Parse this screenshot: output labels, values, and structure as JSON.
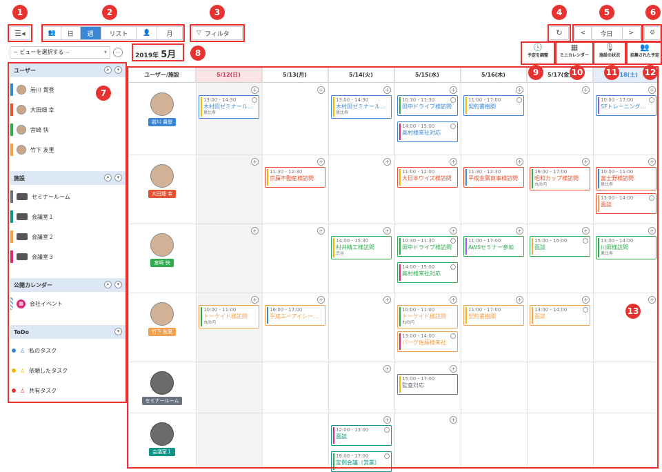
{
  "toolbar": {
    "view_day": "日",
    "view_week": "週",
    "view_list": "リスト",
    "view_month": "月",
    "filter": "フィルタ",
    "prev": "<",
    "today": "今日",
    "next": ">"
  },
  "date_label": {
    "year": "2019年",
    "month": "5月"
  },
  "view_select": "-- ビューを選択する --",
  "actions": {
    "adjust": "予定を調整",
    "minical": "ミニカレンダー",
    "facility": "施設の状況",
    "invited": "招集された予定"
  },
  "sidebar": {
    "users_title": "ユーザー",
    "users": [
      {
        "name": "岩川 貴登",
        "color": "#3a86d6"
      },
      {
        "name": "大田畑 幸",
        "color": "#e8512f"
      },
      {
        "name": "宮崎 快",
        "color": "#2faa4f"
      },
      {
        "name": "竹下 友里",
        "color": "#f5a04a"
      }
    ],
    "facilities_title": "施設",
    "facilities": [
      {
        "name": "セミナールーム",
        "color": "#6b7280"
      },
      {
        "name": "会議室１",
        "color": "#0d9488"
      },
      {
        "name": "会議室２",
        "color": "#f5a04a"
      },
      {
        "name": "会議室３",
        "color": "#db2777"
      }
    ],
    "public_title": "公開カレンダー",
    "public": [
      {
        "name": "会社イベント"
      }
    ],
    "todo_title": "ToDo",
    "todo": [
      {
        "name": "私のタスク",
        "color": "#3a86d6"
      },
      {
        "name": "依頼したタスク",
        "color": "#f5b400"
      },
      {
        "name": "共有タスク",
        "color": "#e8322f"
      }
    ]
  },
  "grid": {
    "corner": "ユーザー/施設",
    "days": [
      "5/12(日)",
      "5/13(月)",
      "5/14(火)",
      "5/15(水)",
      "5/16(木)",
      "5/17(金)",
      "5/18(土)"
    ],
    "rows": [
      {
        "name": "岩川 貴登",
        "tag": "#3a86d6"
      },
      {
        "name": "大田畑 幸",
        "tag": "#e8512f"
      },
      {
        "name": "宮崎 快",
        "tag": "#2faa4f"
      },
      {
        "name": "竹下 友里",
        "tag": "#f5a04a"
      },
      {
        "name": "セミナールーム",
        "tag": "#6b7280"
      },
      {
        "name": "会議室１",
        "tag": "#0d9488"
      }
    ],
    "events": [
      {
        "row": 0,
        "day": 0,
        "slot": 0,
        "time": "13:00 - 14:30",
        "title": "木村田ゼミナール…",
        "loc": "恵比寿",
        "color": "#3a86d6",
        "bar": "#f5b400",
        "mark": true
      },
      {
        "row": 0,
        "day": 2,
        "slot": 0,
        "time": "13:00 - 14:30",
        "title": "木村田ゼミナール…",
        "loc": "恵比寿",
        "color": "#3a86d6",
        "bar": "#f5b400",
        "mark": false
      },
      {
        "row": 0,
        "day": 3,
        "slot": 0,
        "time": "10:30 - 11:30",
        "title": "田中ドライブ様訪問",
        "loc": "",
        "color": "#3a86d6",
        "bar": "#2faa4f",
        "mark": true
      },
      {
        "row": 0,
        "day": 3,
        "slot": 1,
        "time": "14:00 - 15:00",
        "title": "高村様来社対応",
        "loc": "",
        "color": "#3a86d6",
        "bar": "#db2777",
        "mark": true
      },
      {
        "row": 0,
        "day": 4,
        "slot": 0,
        "time": "11:00 - 17:00",
        "title": "契約書樹脚",
        "loc": "",
        "color": "#3a86d6",
        "bar": "#f5b400",
        "mark": true
      },
      {
        "row": 0,
        "day": 6,
        "slot": 0,
        "time": "10:00 - 17:00",
        "title": "SFトレーニング…",
        "loc": "",
        "color": "#3a86d6",
        "bar": "#8b5cf6",
        "mark": true
      },
      {
        "row": 1,
        "day": 1,
        "slot": 0,
        "time": "11:30 - 12:30",
        "title": "京藤不動産様訪問",
        "loc": "",
        "color": "#e8512f",
        "bar": "#f5b400",
        "mark": false
      },
      {
        "row": 1,
        "day": 3,
        "slot": 0,
        "time": "11:00 - 12:00",
        "title": "大日本ワイズ様訪問",
        "loc": "",
        "color": "#e8512f",
        "bar": "#f5b400",
        "mark": false
      },
      {
        "row": 1,
        "day": 4,
        "slot": 0,
        "time": "11:30 - 12:30",
        "title": "平成金属商事様訪問",
        "loc": "",
        "color": "#e8512f",
        "bar": "#3a86d6",
        "mark": false
      },
      {
        "row": 1,
        "day": 5,
        "slot": 0,
        "time": "16:00 - 17:00",
        "title": "昭和カップ様訪問",
        "loc": "丸の内",
        "color": "#e8512f",
        "bar": "#2faa4f",
        "mark": false
      },
      {
        "row": 1,
        "day": 6,
        "slot": 0,
        "time": "10:00 - 11:00",
        "title": "富士野様訪問",
        "loc": "恵比寿",
        "color": "#e8512f",
        "bar": "#3a86d6",
        "mark": false
      },
      {
        "row": 1,
        "day": 6,
        "slot": 1,
        "time": "13:00 - 14:00",
        "title": "面談",
        "loc": "",
        "color": "#e8512f",
        "bar": "#f5a04a",
        "mark": true
      },
      {
        "row": 2,
        "day": 2,
        "slot": 0,
        "time": "14:00 - 15:30",
        "title": "村井精工様訪問",
        "loc": "渋谷",
        "color": "#2faa4f",
        "bar": "#f5b400",
        "mark": false
      },
      {
        "row": 2,
        "day": 3,
        "slot": 0,
        "time": "10:30 - 11:30",
        "title": "田中ドライブ様訪問",
        "loc": "",
        "color": "#2faa4f",
        "bar": "#2faa4f",
        "mark": true
      },
      {
        "row": 2,
        "day": 3,
        "slot": 1,
        "time": "14:00 - 15:00",
        "title": "高村様来社対応",
        "loc": "",
        "color": "#2faa4f",
        "bar": "#db2777",
        "mark": true
      },
      {
        "row": 2,
        "day": 4,
        "slot": 0,
        "time": "11:00 - 17:00",
        "title": "AWSセミナー参加",
        "loc": "",
        "color": "#2faa4f",
        "bar": "#8b5cf6",
        "mark": false
      },
      {
        "row": 2,
        "day": 5,
        "slot": 0,
        "time": "15:00 - 16:00",
        "title": "面談",
        "loc": "",
        "color": "#2faa4f",
        "bar": "#f5a04a",
        "mark": true
      },
      {
        "row": 2,
        "day": 6,
        "slot": 0,
        "time": "13:00 - 14:00",
        "title": "川田様訪問",
        "loc": "恵比寿",
        "color": "#2faa4f",
        "bar": "#2faa4f",
        "mark": false
      },
      {
        "row": 3,
        "day": 0,
        "slot": 0,
        "time": "10:00 - 11:00",
        "title": "トーケイド様訪問",
        "loc": "丸の内",
        "color": "#f5a04a",
        "bar": "#2faa4f",
        "mark": false
      },
      {
        "row": 3,
        "day": 1,
        "slot": 0,
        "time": "16:00 - 17:00",
        "title": "平成エーアイシー…",
        "loc": "",
        "color": "#f5a04a",
        "bar": "#3a86d6",
        "mark": false
      },
      {
        "row": 3,
        "day": 3,
        "slot": 0,
        "time": "10:00 - 11:00",
        "title": "トーケイド様訪問",
        "loc": "丸の内",
        "color": "#f5a04a",
        "bar": "#2faa4f",
        "mark": false
      },
      {
        "row": 3,
        "day": 3,
        "slot": 1,
        "time": "13:00 - 14:00",
        "title": "バーグ佐藤様来社",
        "loc": "",
        "color": "#f5a04a",
        "bar": "#db2777",
        "mark": true
      },
      {
        "row": 3,
        "day": 4,
        "slot": 0,
        "time": "11:00 - 17:00",
        "title": "契約書樹脚",
        "loc": "",
        "color": "#f5a04a",
        "bar": "#f5b400",
        "mark": false
      },
      {
        "row": 3,
        "day": 5,
        "slot": 0,
        "time": "13:00 - 14:00",
        "title": "面談",
        "loc": "",
        "color": "#f5a04a",
        "bar": "#f5a04a",
        "mark": true
      },
      {
        "row": 4,
        "day": 3,
        "slot": 0,
        "time": "15:00 - 17:00",
        "title": "監査対応",
        "loc": "",
        "color": "#6b7280",
        "bar": "#f5b400",
        "mark": false
      },
      {
        "row": 5,
        "day": 2,
        "slot": 0,
        "time": "12:00 - 13:00",
        "title": "面談",
        "loc": "",
        "color": "#0d9488",
        "bar": "#db2777",
        "mark": true
      },
      {
        "row": 5,
        "day": 2,
        "slot": 1,
        "time": "16:00 - 17:00",
        "title": "定例会議（営業）",
        "loc": "",
        "color": "#0d9488",
        "bar": "#2faa4f",
        "mark": true
      }
    ]
  },
  "callouts": [
    "1",
    "2",
    "3",
    "4",
    "5",
    "6",
    "7",
    "8",
    "9",
    "10",
    "11",
    "12",
    "13"
  ]
}
